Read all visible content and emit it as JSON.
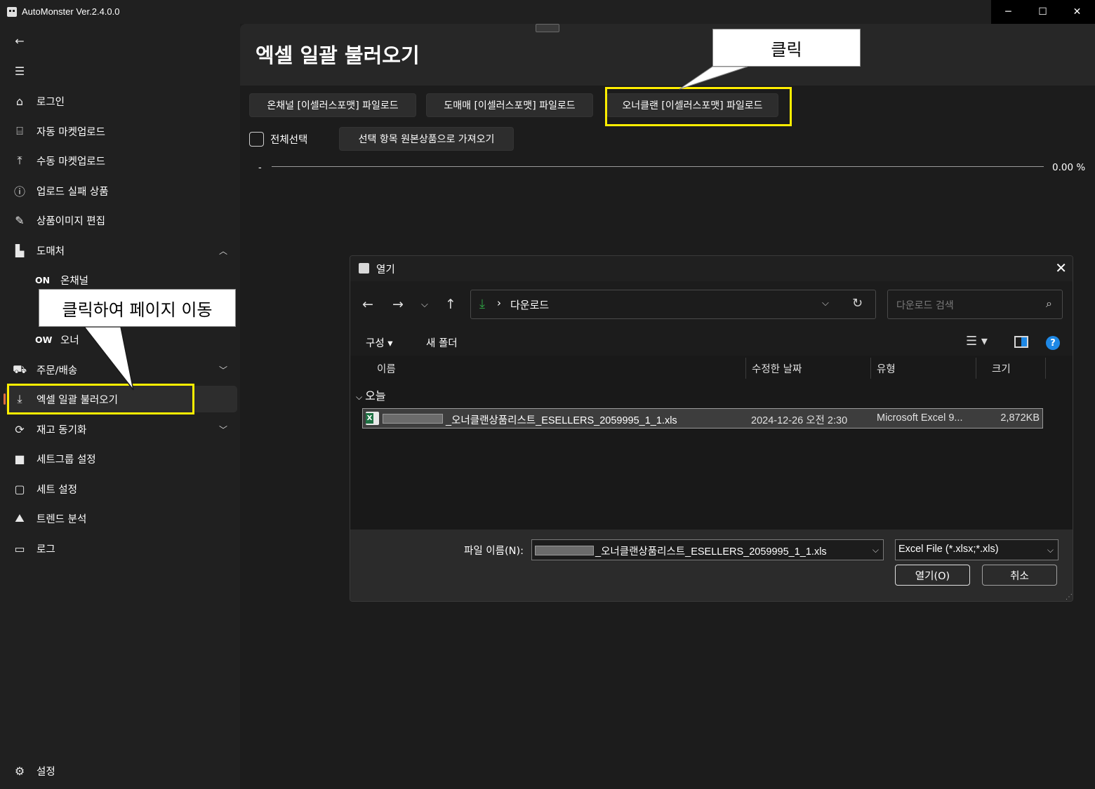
{
  "window": {
    "title": "AutoMonster Ver.2.4.0.0",
    "controls": [
      "─",
      "☐",
      "✕"
    ]
  },
  "sidebar": {
    "back_icon": "arrow-left-icon",
    "menu_icon": "hamburger-icon",
    "items": [
      {
        "label": "로그인",
        "icon": "home-icon"
      },
      {
        "label": "자동 마켓업로드",
        "icon": "robot-icon"
      },
      {
        "label": "수동 마켓업로드",
        "icon": "upload-icon"
      },
      {
        "label": "업로드 실패 상품",
        "icon": "alert-circle-icon"
      },
      {
        "label": "상품이미지 편집",
        "icon": "brush-icon"
      },
      {
        "label": "도매처",
        "icon": "building-icon"
      },
      {
        "label": "주문/배송",
        "icon": "cart-icon"
      },
      {
        "label": "엑셀 일괄 불러오기",
        "icon": "download-icon"
      },
      {
        "label": "재고 동기화",
        "icon": "sync-icon"
      },
      {
        "label": "세트그룹 설정",
        "icon": "square-filled-icon"
      },
      {
        "label": "세트 설정",
        "icon": "square-outline-icon"
      },
      {
        "label": "트렌드 분석",
        "icon": "chart-area-icon"
      },
      {
        "label": "로그",
        "icon": "log-icon"
      }
    ],
    "subitems": [
      {
        "prefix": "ON",
        "label": "온채널"
      },
      {
        "prefix": "OW",
        "label": "오너"
      }
    ],
    "settings_label": "설정"
  },
  "main": {
    "title": "엑셀 일괄 불러오기",
    "buttons": [
      "온채널 [이셀러스포맷] 파일로드",
      "도매매 [이셀러스포맷] 파일로드",
      "오너클랜 [이셀러스포맷] 파일로드"
    ],
    "select_all_label": "전체선택",
    "import_button": "선택 항목 원본상품으로 가져오기",
    "progress_label": "-",
    "progress_percent": 0.0,
    "progress_text": "0.00 %"
  },
  "annotations": {
    "click_callout": "클릭",
    "nav_callout": "클릭하여 페이지 이동",
    "highlight_color": "#ffee00"
  },
  "dialog": {
    "title": "열기",
    "close": "✕",
    "address": "다운로드",
    "search_placeholder": "다운로드 검색",
    "organize": "구성 ▾",
    "new_folder": "새 폴더",
    "help": "?",
    "columns": [
      "이름",
      "수정한 날짜",
      "유형",
      "크기"
    ],
    "group": "오늘",
    "files": [
      {
        "name": "_오너클랜상품리스트_ESELLERS_2059995_1_1.xls",
        "date": "2024-12-26 오전 2:30",
        "type": "Microsoft Excel 9...",
        "size": "2,872KB"
      }
    ],
    "filename_label": "파일 이름(N):",
    "filename_value": "_오너클랜상품리스트_ESELLERS_2059995_1_1.xls",
    "filetype_value": "Excel File (*.xlsx;*.xls)",
    "open_button": "열기(O)",
    "cancel_button": "취소"
  },
  "colors": {
    "background": "#202020",
    "main_bg": "#1c1c1c",
    "accent_indicator": "#e06c3c",
    "excel_green": "#1f7244",
    "download_green": "#2ea043",
    "help_blue": "#1e88e5"
  }
}
